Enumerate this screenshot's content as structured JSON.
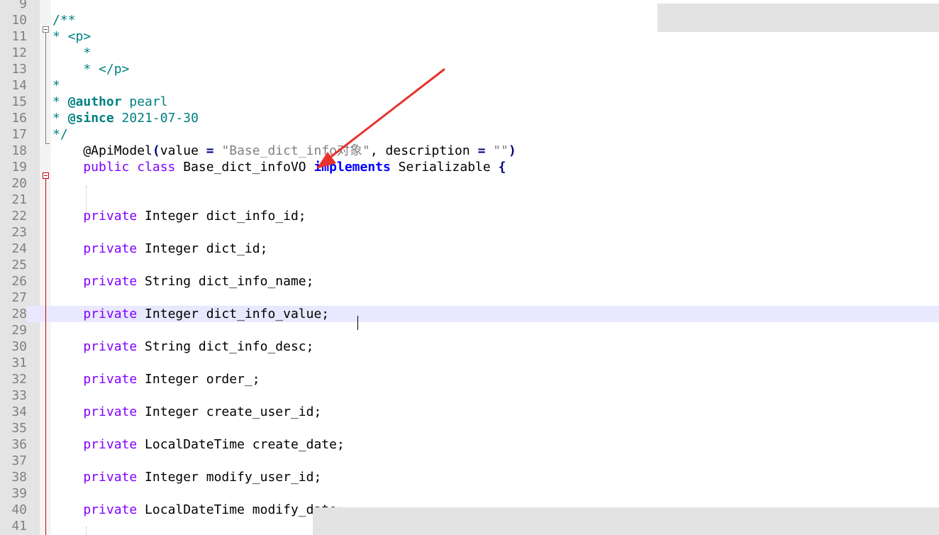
{
  "lines": [
    {
      "num": "9",
      "segments": []
    },
    {
      "num": "10",
      "segments": [
        {
          "cls": "cmt",
          "text": "/**"
        }
      ]
    },
    {
      "num": "11",
      "segments": [
        {
          "cls": "cmt",
          "text": "* <p>"
        }
      ]
    },
    {
      "num": "12",
      "segments": [
        {
          "cls": "cmt",
          "text": "    *"
        }
      ]
    },
    {
      "num": "13",
      "segments": [
        {
          "cls": "cmt",
          "text": "    * </p>"
        }
      ]
    },
    {
      "num": "14",
      "segments": [
        {
          "cls": "cmt",
          "text": "*"
        }
      ]
    },
    {
      "num": "15",
      "segments": [
        {
          "cls": "cmt",
          "text": "* "
        },
        {
          "cls": "tag",
          "text": "@author"
        },
        {
          "cls": "cmt",
          "text": " pearl"
        }
      ]
    },
    {
      "num": "16",
      "segments": [
        {
          "cls": "cmt",
          "text": "* "
        },
        {
          "cls": "tag",
          "text": "@since"
        },
        {
          "cls": "cmt",
          "text": " 2021-07-30"
        }
      ]
    },
    {
      "num": "17",
      "segments": [
        {
          "cls": "cmt",
          "text": "*/"
        }
      ]
    },
    {
      "num": "18",
      "segments": [
        {
          "cls": "",
          "text": "    @ApiModel"
        },
        {
          "cls": "op",
          "text": "("
        },
        {
          "cls": "",
          "text": "value "
        },
        {
          "cls": "op",
          "text": "="
        },
        {
          "cls": "",
          "text": " "
        },
        {
          "cls": "str",
          "text": "\"Base_dict_info对象\""
        },
        {
          "cls": "",
          "text": ", description "
        },
        {
          "cls": "op",
          "text": "="
        },
        {
          "cls": "",
          "text": " "
        },
        {
          "cls": "str",
          "text": "\"\""
        },
        {
          "cls": "op",
          "text": ")"
        }
      ]
    },
    {
      "num": "19",
      "segments": [
        {
          "cls": "kw-purple",
          "text": "    public class"
        },
        {
          "cls": "",
          "text": " Base_dict_infoVO "
        },
        {
          "cls": "kw-blue",
          "text": "implements"
        },
        {
          "cls": "",
          "text": " Serializable "
        },
        {
          "cls": "op",
          "text": "{"
        }
      ]
    },
    {
      "num": "20",
      "segments": []
    },
    {
      "num": "21",
      "segments": []
    },
    {
      "num": "22",
      "segments": [
        {
          "cls": "kw-purple",
          "text": "    private"
        },
        {
          "cls": "",
          "text": " Integer dict_info_id;"
        }
      ]
    },
    {
      "num": "23",
      "segments": []
    },
    {
      "num": "24",
      "segments": [
        {
          "cls": "kw-purple",
          "text": "    private"
        },
        {
          "cls": "",
          "text": " Integer dict_id;"
        }
      ]
    },
    {
      "num": "25",
      "segments": []
    },
    {
      "num": "26",
      "segments": [
        {
          "cls": "kw-purple",
          "text": "    private"
        },
        {
          "cls": "",
          "text": " String dict_info_name;"
        }
      ]
    },
    {
      "num": "27",
      "segments": []
    },
    {
      "num": "28",
      "segments": [
        {
          "cls": "kw-purple",
          "text": "    private"
        },
        {
          "cls": "",
          "text": " Integer dict_info_value;"
        }
      ],
      "current": true
    },
    {
      "num": "29",
      "segments": []
    },
    {
      "num": "30",
      "segments": [
        {
          "cls": "kw-purple",
          "text": "    private"
        },
        {
          "cls": "",
          "text": " String dict_info_desc;"
        }
      ]
    },
    {
      "num": "31",
      "segments": []
    },
    {
      "num": "32",
      "segments": [
        {
          "cls": "kw-purple",
          "text": "    private"
        },
        {
          "cls": "",
          "text": " Integer order_;"
        }
      ]
    },
    {
      "num": "33",
      "segments": []
    },
    {
      "num": "34",
      "segments": [
        {
          "cls": "kw-purple",
          "text": "    private"
        },
        {
          "cls": "",
          "text": " Integer create_user_id;"
        }
      ]
    },
    {
      "num": "35",
      "segments": []
    },
    {
      "num": "36",
      "segments": [
        {
          "cls": "kw-purple",
          "text": "    private"
        },
        {
          "cls": "",
          "text": " LocalDateTime create_date;"
        }
      ]
    },
    {
      "num": "37",
      "segments": []
    },
    {
      "num": "38",
      "segments": [
        {
          "cls": "kw-purple",
          "text": "    private"
        },
        {
          "cls": "",
          "text": " Integer modify_user_id;"
        }
      ]
    },
    {
      "num": "39",
      "segments": []
    },
    {
      "num": "40",
      "segments": [
        {
          "cls": "kw-purple",
          "text": "    private"
        },
        {
          "cls": "",
          "text": " LocalDateTime modify_date;"
        }
      ]
    },
    {
      "num": "41",
      "segments": []
    }
  ],
  "colors": {
    "comment": "#008080",
    "keyword": "#8000ff",
    "keyword_bold": "#0000ff",
    "string": "#808080",
    "operator": "#000080",
    "current_line": "#e8e8ff",
    "annotation_arrow": "#e8322e"
  }
}
